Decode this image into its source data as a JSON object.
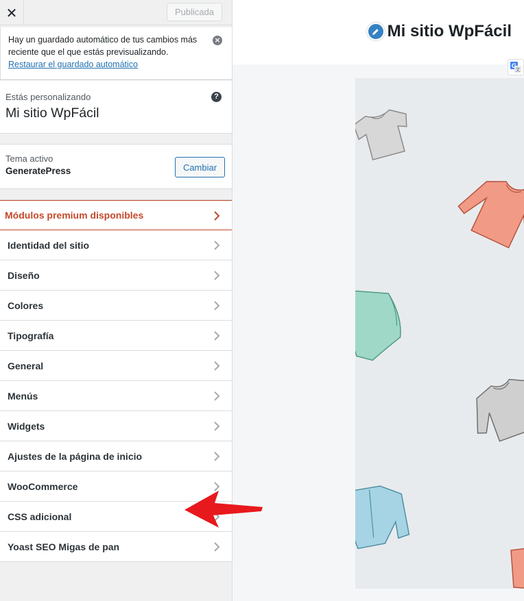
{
  "topbar": {
    "close_symbol": "✕",
    "publish_label": "Publicada"
  },
  "notice": {
    "text": "Hay un guardado automático de tus cambios más reciente que el que estás previsualizando.",
    "link": "Restaurar el guardado automático"
  },
  "customizing": {
    "label": "Estás personalizando",
    "site_name": "Mi sitio WpFácil",
    "help_symbol": "?"
  },
  "theme": {
    "label": "Tema activo",
    "name": "GeneratePress",
    "change_label": "Cambiar"
  },
  "menu": {
    "items": [
      {
        "label": "Módulos premium disponibles"
      },
      {
        "label": "Identidad del sitio"
      },
      {
        "label": "Diseño"
      },
      {
        "label": "Colores"
      },
      {
        "label": "Tipografía"
      },
      {
        "label": "General"
      },
      {
        "label": "Menús"
      },
      {
        "label": "Widgets"
      },
      {
        "label": "Ajustes de la página de inicio"
      },
      {
        "label": "WooCommerce"
      },
      {
        "label": "CSS adicional"
      },
      {
        "label": "Yoast SEO Migas de pan"
      }
    ]
  },
  "preview": {
    "site_title": "Mi sitio WpFácil"
  },
  "colors": {
    "accent": "#2271b1",
    "premium": "#c3482a",
    "arrow": "#e8191c"
  }
}
